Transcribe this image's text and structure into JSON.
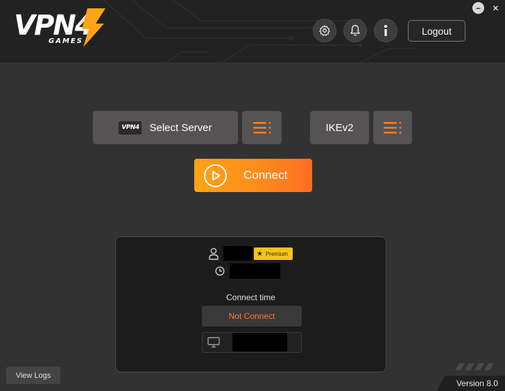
{
  "app": {
    "logo_text": "VPN4",
    "logo_sub": "GAMES"
  },
  "header": {
    "settings_icon": "gear-icon",
    "notifications_icon": "bell-icon",
    "info_icon": "info-icon",
    "logout_label": "Logout",
    "minimize_label": "−",
    "close_label": "✕"
  },
  "controls": {
    "server_badge": "VPN4",
    "select_server_label": "Select Server",
    "protocol_label": "IKEv2",
    "connect_label": "Connect",
    "menu_icon": "menu-list-icon"
  },
  "info": {
    "user_icon": "user-icon",
    "premium_label": "Premium",
    "clock_icon": "clock-icon",
    "connect_time_label": "Connect time",
    "status": "Not Connect",
    "monitor_icon": "monitor-icon"
  },
  "footer": {
    "view_logs_label": "View Logs",
    "version_label": "Version 8.0"
  },
  "colors": {
    "accent": "#ff8a1c",
    "status": "#ff7a2a",
    "premium": "#f5c21a"
  }
}
